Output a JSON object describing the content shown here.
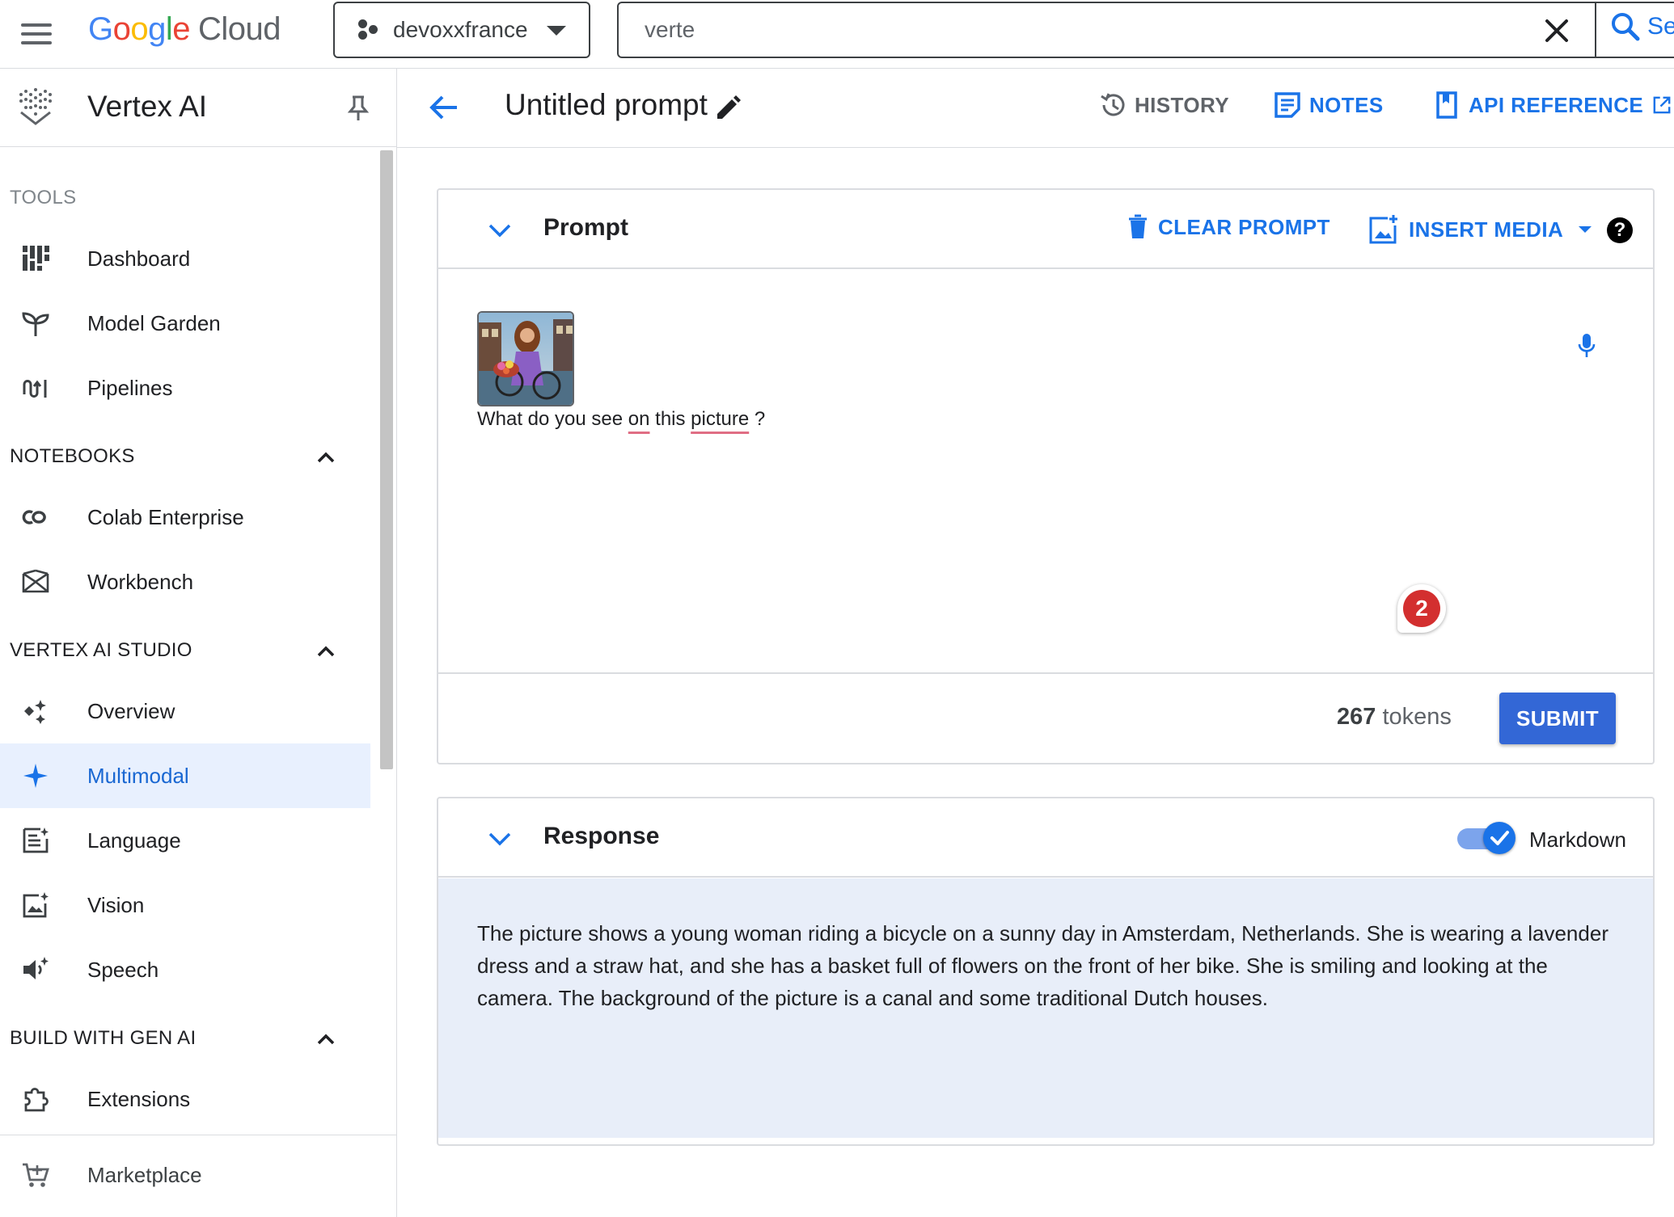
{
  "topbar": {
    "logo_google": [
      "G",
      "o",
      "o",
      "g",
      "l",
      "e"
    ],
    "logo_cloud": "Cloud",
    "project": "devoxxfrance",
    "search_value": "verte",
    "search_button": "Se"
  },
  "sidebar": {
    "title": "Vertex AI",
    "sections": {
      "tools": "TOOLS",
      "notebooks": "NOTEBOOKS",
      "studio": "VERTEX AI STUDIO",
      "build": "BUILD WITH GEN AI"
    },
    "items": {
      "dashboard": "Dashboard",
      "model_garden": "Model Garden",
      "pipelines": "Pipelines",
      "colab": "Colab Enterprise",
      "workbench": "Workbench",
      "overview": "Overview",
      "multimodal": "Multimodal",
      "language": "Language",
      "vision": "Vision",
      "speech": "Speech",
      "extensions": "Extensions",
      "marketplace": "Marketplace"
    },
    "active_item": "Multimodal"
  },
  "header": {
    "title": "Untitled prompt",
    "history": "HISTORY",
    "notes": "NOTES",
    "api_reference": "API REFERENCE"
  },
  "prompt": {
    "title": "Prompt",
    "clear": "CLEAR PROMPT",
    "insert_media": "INSERT MEDIA",
    "help": "?",
    "text_parts": [
      "What do you see ",
      "on",
      " this ",
      "picture",
      "  ?"
    ],
    "badge_count": "2",
    "tokens_count": "267",
    "tokens_label": " tokens",
    "submit": "SUBMIT"
  },
  "response": {
    "title": "Response",
    "markdown_label": "Markdown",
    "markdown_on": true,
    "text": "The picture shows a young woman riding a bicycle on a sunny day in Amsterdam, Netherlands. She is wearing a lavender dress and a straw hat, and she has a basket full of flowers on the front of her bike. She is smiling and looking at the camera. The background of the picture is a canal and some traditional Dutch houses."
  },
  "colors": {
    "accent": "#1a73e8",
    "submit": "#3367d6",
    "active_nav_bg": "#e8f0fe",
    "response_bg": "#e8eef9",
    "badge": "#d32f2f"
  },
  "icons": [
    "menu-icon",
    "project-icon",
    "close-icon",
    "search-icon",
    "vertex-logo-icon",
    "pin-icon",
    "dashboard-icon",
    "model-garden-icon",
    "pipelines-icon",
    "colab-icon",
    "workbench-icon",
    "overview-icon",
    "multimodal-icon",
    "language-icon",
    "vision-icon",
    "speech-icon",
    "extensions-icon",
    "marketplace-icon",
    "back-arrow-icon",
    "edit-icon",
    "history-icon",
    "notes-icon",
    "api-reference-icon",
    "external-link-icon",
    "chevron-down-icon",
    "chevron-up-icon",
    "trash-icon",
    "insert-media-icon",
    "dropdown-caret-icon",
    "help-icon",
    "mic-icon",
    "check-icon"
  ]
}
